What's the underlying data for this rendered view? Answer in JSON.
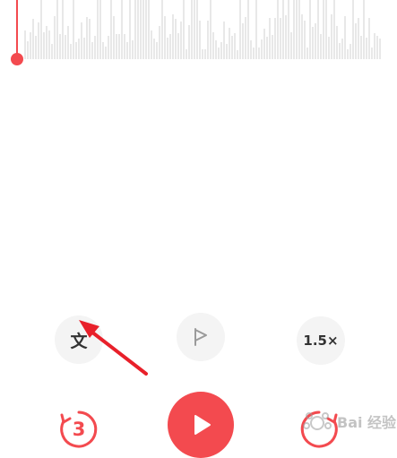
{
  "player": {
    "accent_color": "#f34a4f",
    "waveform_color": "#d9d9d9",
    "progress": 0
  },
  "controls": {
    "transcribe_label": "文",
    "transcribe_icon": "text-transcribe-icon",
    "mark_icon": "flag-icon",
    "speed_label": "1.5×",
    "skip_back_label": "3",
    "skip_back_icon": "rewind-3s-icon",
    "play_icon": "play-icon",
    "skip_forward_icon": "forward-icon"
  },
  "watermark": {
    "text": "Bai 经验"
  }
}
